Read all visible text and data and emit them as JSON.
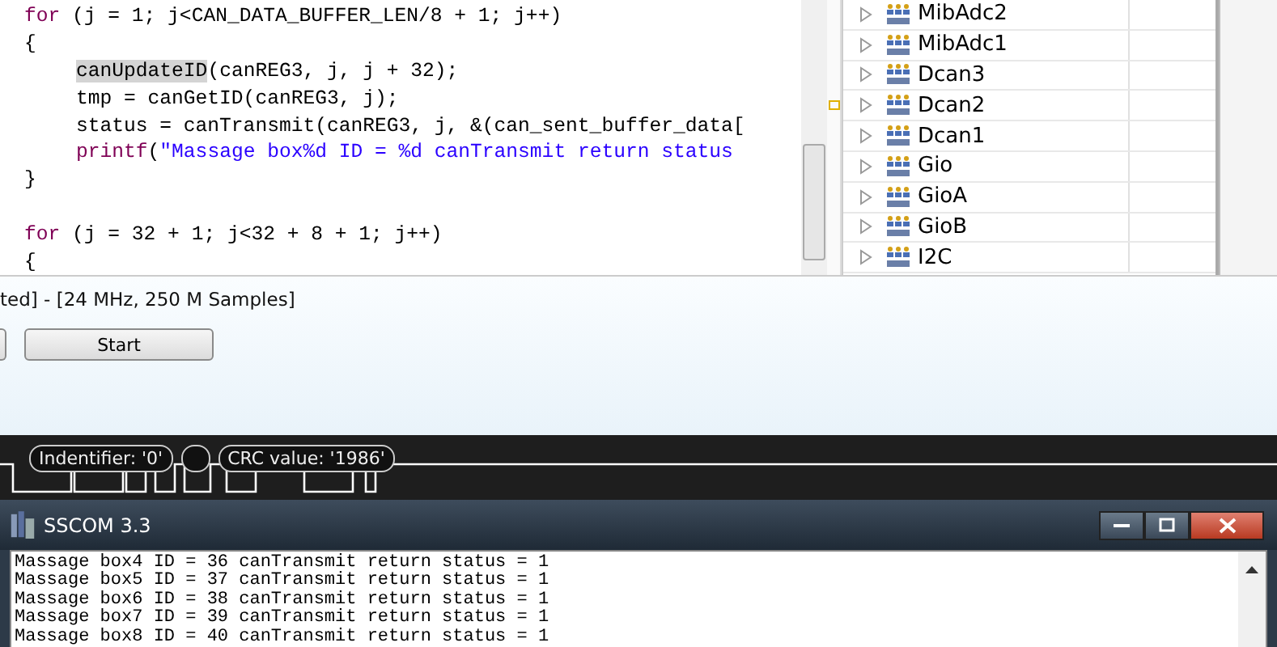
{
  "editor": {
    "lines": [
      {
        "kind": "code",
        "indented": false,
        "tokens": [
          {
            "kind": "keyword",
            "text": "for"
          },
          {
            "kind": "plain",
            "text": " (j = 1; j<CAN_DATA_BUFFER_LEN/8 + 1; j++)"
          }
        ]
      },
      {
        "kind": "code",
        "indented": false,
        "tokens": [
          {
            "kind": "plain",
            "text": "{"
          }
        ]
      },
      {
        "kind": "code",
        "indented": true,
        "tokens": [
          {
            "kind": "highlight",
            "text": "canUpdateID"
          },
          {
            "kind": "plain",
            "text": "(canREG3, j, j + 32);"
          }
        ]
      },
      {
        "kind": "code",
        "indented": true,
        "tokens": [
          {
            "kind": "plain",
            "text": "tmp = canGetID(canREG3, j);"
          }
        ]
      },
      {
        "kind": "code",
        "indented": true,
        "tokens": [
          {
            "kind": "plain",
            "text": "status = canTransmit(canREG3, j, &(can_sent_buffer_data["
          }
        ]
      },
      {
        "kind": "code",
        "indented": true,
        "tokens": [
          {
            "kind": "keyword",
            "text": "printf"
          },
          {
            "kind": "plain",
            "text": "("
          },
          {
            "kind": "string",
            "text": "\"Massage box%d ID = %d canTransmit return status"
          }
        ]
      },
      {
        "kind": "code",
        "indented": false,
        "tokens": [
          {
            "kind": "plain",
            "text": "}"
          }
        ]
      },
      {
        "kind": "blank"
      },
      {
        "kind": "code",
        "indented": false,
        "tokens": [
          {
            "kind": "keyword",
            "text": "for"
          },
          {
            "kind": "plain",
            "text": " (j = 32 + 1; j<32 + 8 + 1; j++)"
          }
        ]
      },
      {
        "kind": "code",
        "indented": false,
        "tokens": [
          {
            "kind": "plain",
            "text": "{"
          }
        ]
      }
    ]
  },
  "register_tree": {
    "items": [
      {
        "label": "MibAdc2",
        "expanded": false
      },
      {
        "label": "MibAdc1",
        "expanded": false
      },
      {
        "label": "Dcan3",
        "expanded": false
      },
      {
        "label": "Dcan2",
        "expanded": false
      },
      {
        "label": "Dcan1",
        "expanded": false
      },
      {
        "label": "Gio",
        "expanded": false
      },
      {
        "label": "GioA",
        "expanded": false
      },
      {
        "label": "GioB",
        "expanded": false
      },
      {
        "label": "I2C",
        "expanded": false
      }
    ]
  },
  "analyzer": {
    "title": "ted] - [24 MHz, 250 M Samples]",
    "button": "Start",
    "decoded": [
      {
        "kind": "field",
        "text": "Indentifier: '0'"
      },
      {
        "kind": "blank"
      },
      {
        "kind": "field",
        "text": "CRC value: '1986'"
      }
    ]
  },
  "terminal": {
    "title": "SSCOM 3.3",
    "lines": [
      "Massage box4 ID = 36 canTransmit return status = 1",
      "Massage box5 ID = 37 canTransmit return status = 1",
      "Massage box6 ID = 38 canTransmit return status = 1",
      "Massage box7 ID = 39 canTransmit return status = 1",
      "Massage box8 ID = 40 canTransmit return status = 1"
    ]
  }
}
